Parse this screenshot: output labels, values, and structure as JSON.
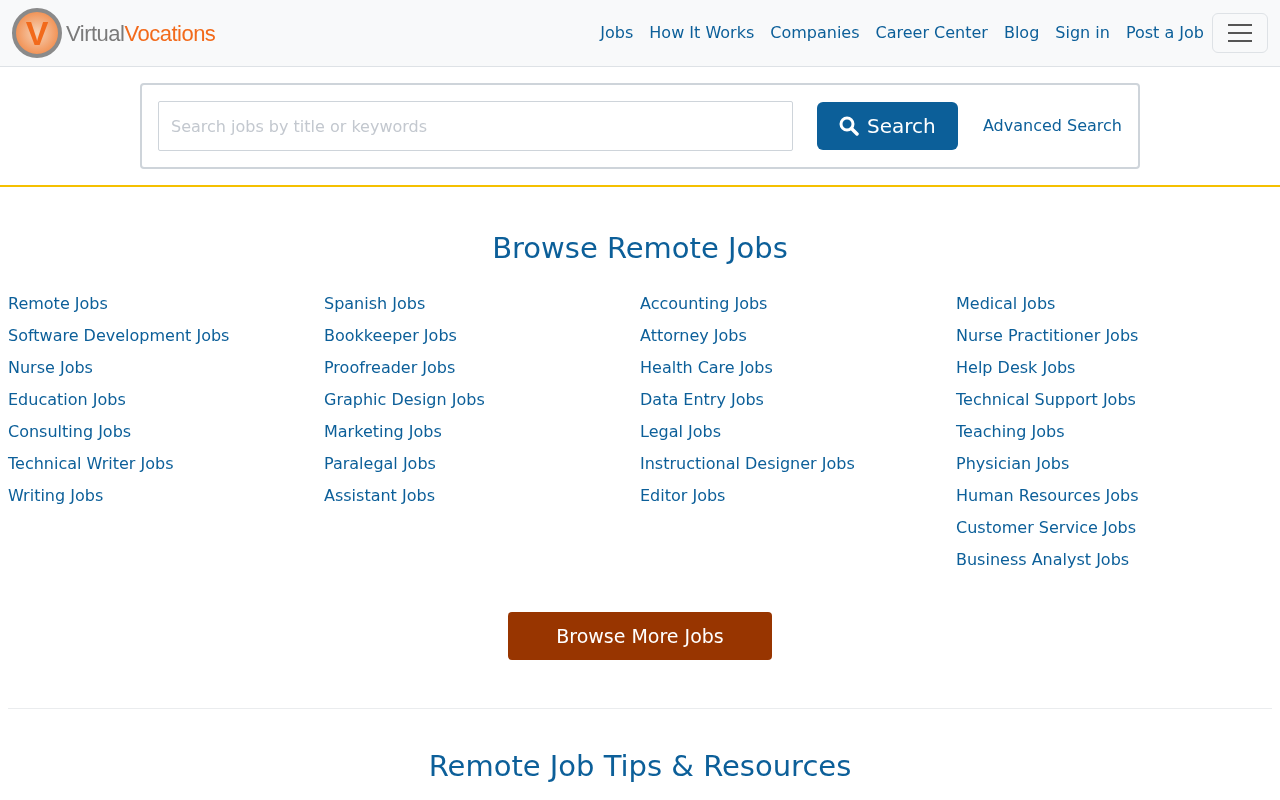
{
  "logo": {
    "mark": "V",
    "first": "Virtual",
    "second": "Vocations"
  },
  "nav": [
    "Jobs",
    "How It Works",
    "Companies",
    "Career Center",
    "Blog",
    "Sign in",
    "Post a Job"
  ],
  "search": {
    "placeholder": "Search jobs by title or keywords",
    "button": "Search",
    "advanced": "Advanced Search"
  },
  "browse": {
    "title": "Browse Remote Jobs",
    "columns": [
      [
        "Remote Jobs",
        "Software Development Jobs",
        "Nurse Jobs",
        "Education Jobs",
        "Consulting Jobs",
        "Technical Writer Jobs",
        "Writing Jobs"
      ],
      [
        "Spanish Jobs",
        "Bookkeeper Jobs",
        "Proofreader Jobs",
        "Graphic Design Jobs",
        "Marketing Jobs",
        "Paralegal Jobs",
        "Assistant Jobs"
      ],
      [
        "Accounting Jobs",
        "Attorney Jobs",
        "Health Care Jobs",
        "Data Entry Jobs",
        "Legal Jobs",
        "Instructional Designer Jobs",
        "Editor Jobs"
      ],
      [
        "Medical Jobs",
        "Nurse Practitioner Jobs",
        "Help Desk Jobs",
        "Technical Support Jobs",
        "Teaching Jobs",
        "Physician Jobs",
        "Human Resources Jobs",
        "Customer Service Jobs",
        "Business Analyst Jobs"
      ]
    ],
    "more_button": "Browse More Jobs"
  },
  "tips": {
    "title": "Remote Job Tips & Resources"
  }
}
